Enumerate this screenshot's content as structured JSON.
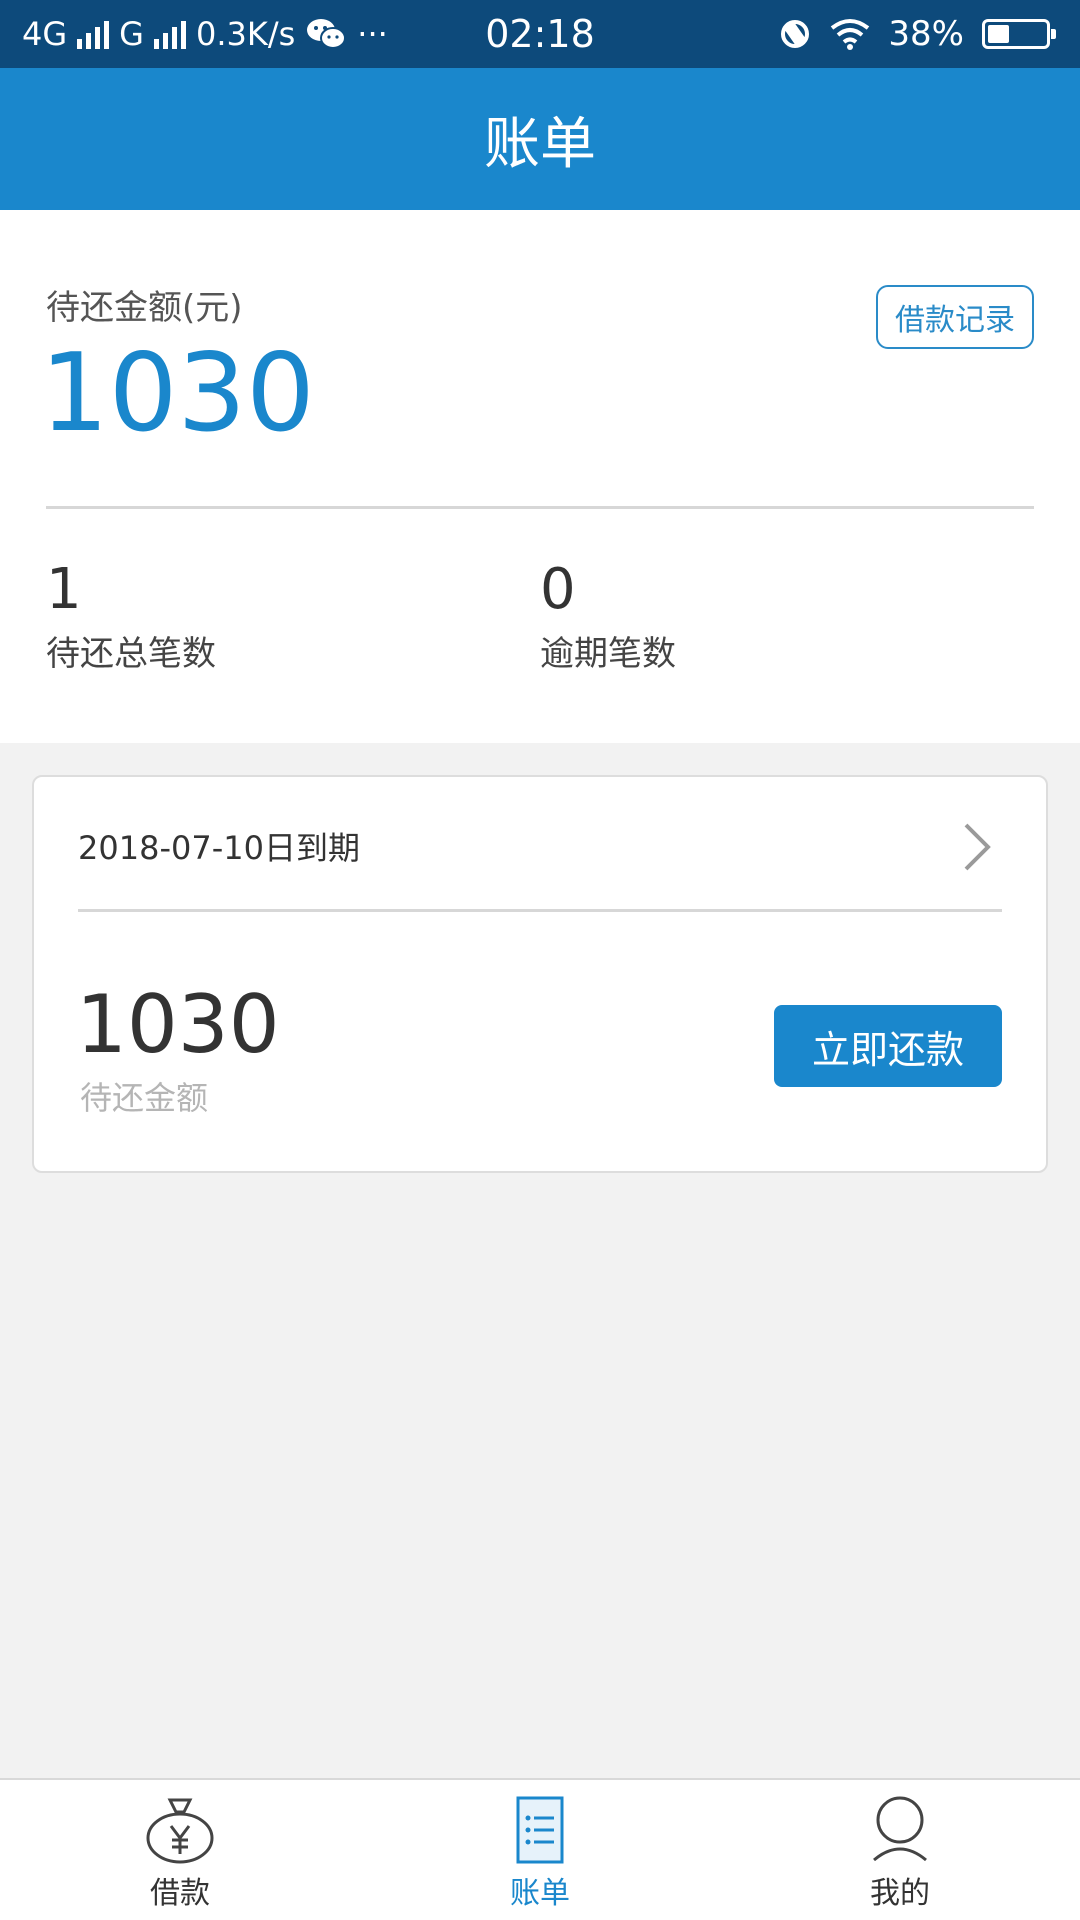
{
  "status_bar": {
    "network1": "4G",
    "network2": "G",
    "speed": "0.3K/s",
    "more": "···",
    "time": "02:18",
    "battery": "38%",
    "battery_level": 0.38
  },
  "header": {
    "title": "账单"
  },
  "summary": {
    "due_label": "待还金额(元)",
    "due_amount": "1030",
    "record_button": "借款记录",
    "pending_count": "1",
    "pending_label": "待还总笔数",
    "overdue_count": "0",
    "overdue_label": "逾期笔数"
  },
  "bill": {
    "due_date": "2018-07-10日到期",
    "amount": "1030",
    "amount_label": "待还金额",
    "repay_button": "立即还款"
  },
  "bottom_nav": {
    "items": [
      {
        "label": "借款",
        "icon": "money-bag-icon",
        "active": false
      },
      {
        "label": "账单",
        "icon": "bill-list-icon",
        "active": true
      },
      {
        "label": "我的",
        "icon": "user-icon",
        "active": false
      }
    ]
  },
  "colors": {
    "primary": "#1a87cc",
    "status_bar": "#0d4a7b",
    "background": "#f2f2f2"
  }
}
